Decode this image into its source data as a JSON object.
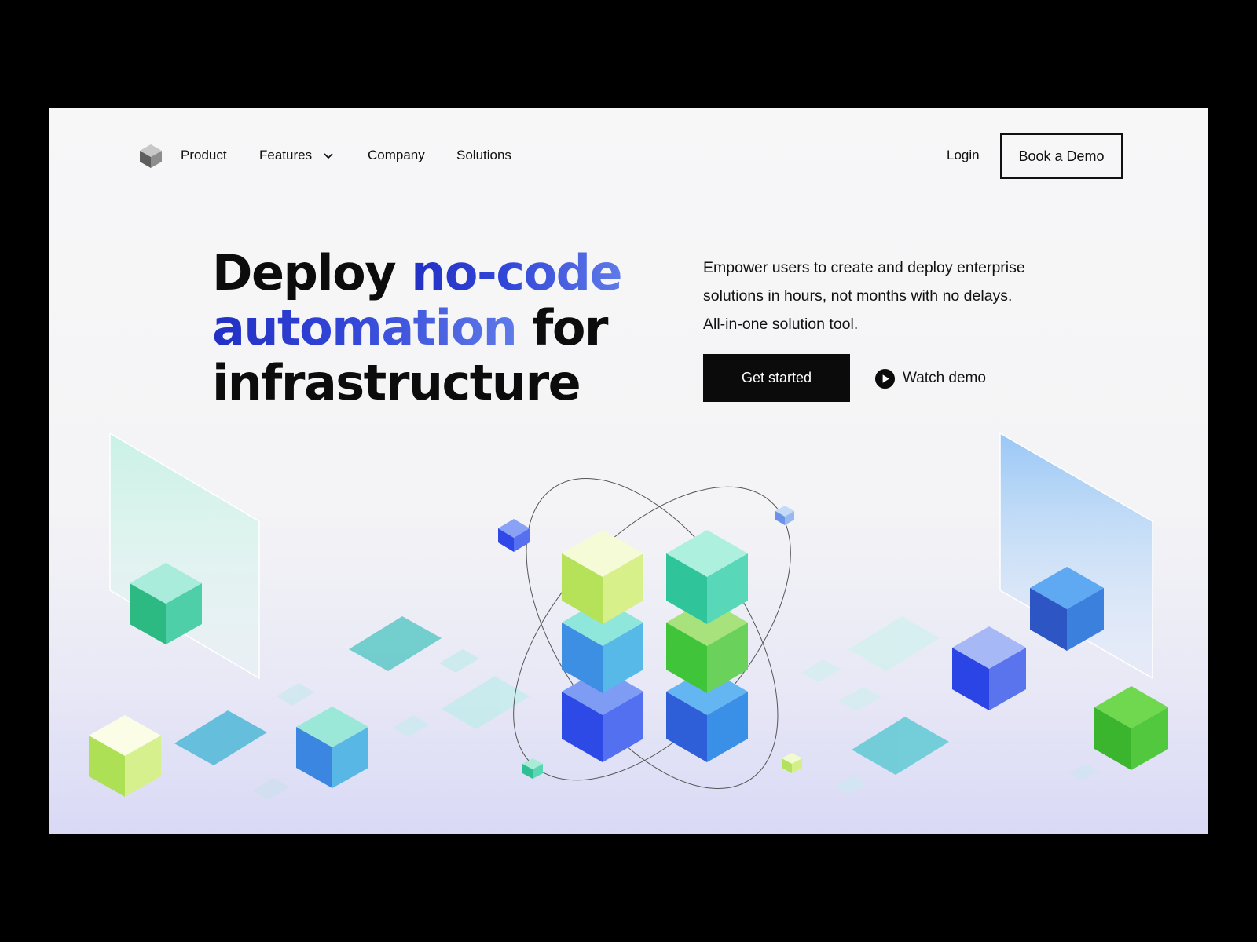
{
  "nav": {
    "logo_icon": "cube-logo-icon",
    "links": [
      "Product",
      "Features",
      "Company",
      "Solutions"
    ],
    "features_icon": "chevron-down-icon",
    "login_label": "Login",
    "book_demo_label": "Book a Demo"
  },
  "hero": {
    "headline_part1": "Deploy ",
    "headline_highlight1": "no-code",
    "headline_highlight2": "automation",
    "headline_part2": " for",
    "headline_part3": "infrastructure",
    "subtext": "Empower users to create and deploy enterprise solutions in hours, not months with no delays. All-in-one solution tool.",
    "cta_primary_label": "Get started",
    "cta_secondary_label": "Watch demo",
    "cta_secondary_icon": "play-circle-icon"
  },
  "colors": {
    "accent_blue": "#2a3bd0",
    "teal": "#3fd6b0",
    "green": "#3fc43a",
    "lime": "#c8ef6a",
    "sky_blue": "#3a8fe6",
    "royal_blue": "#2f4ef0"
  }
}
